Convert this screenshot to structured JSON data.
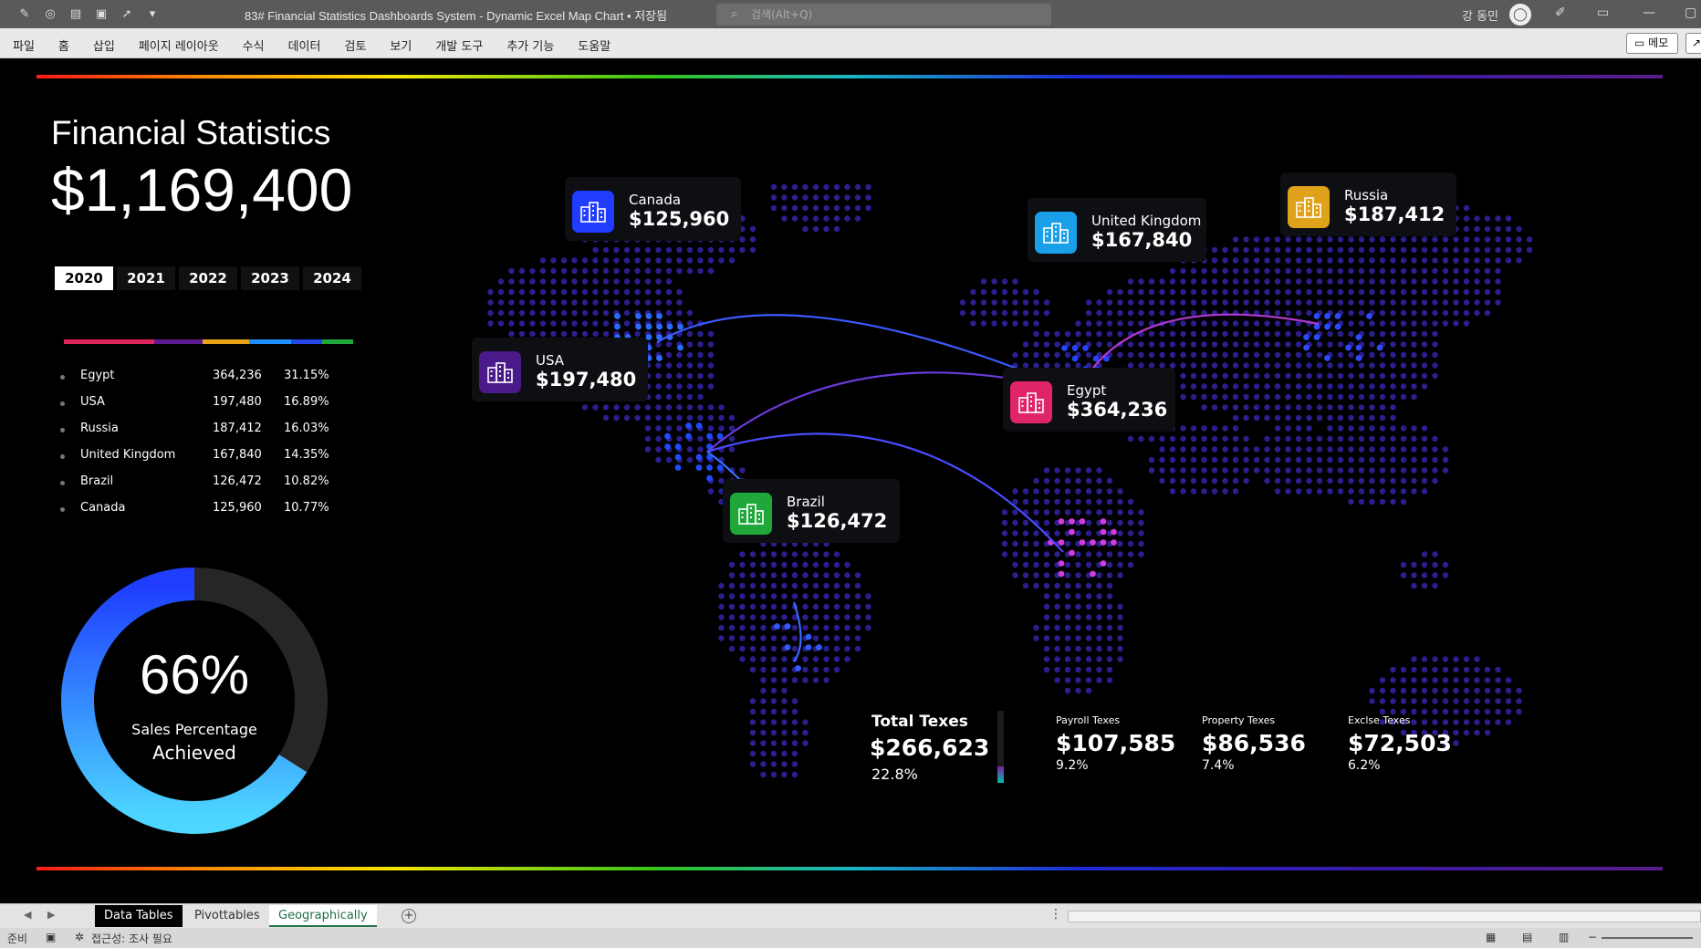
{
  "window": {
    "doc_title": "83# Financial Statistics Dashboards System - Dynamic Excel Map Chart • 저장됨",
    "search_placeholder": "검색(Alt+Q)",
    "user_name": "강 동민"
  },
  "ribbon": {
    "tabs": [
      "파일",
      "홈",
      "삽입",
      "페이지 레이아웃",
      "수식",
      "데이터",
      "검토",
      "보기",
      "개발 도구",
      "추가 기능",
      "도움말"
    ],
    "memo_label": "메모"
  },
  "dashboard": {
    "title": "Financial Statistics",
    "total": "$1,169,400",
    "years": [
      "2020",
      "2021",
      "2022",
      "2023",
      "2024"
    ],
    "active_year": "2020",
    "country_list": [
      {
        "name": "Egypt",
        "value": "364,236",
        "pct": "31.15%"
      },
      {
        "name": "USA",
        "value": "197,480",
        "pct": "16.89%"
      },
      {
        "name": "Russia",
        "value": "187,412",
        "pct": "16.03%"
      },
      {
        "name": "United Kingdom",
        "value": "167,840",
        "pct": "14.35%"
      },
      {
        "name": "Brazil",
        "value": "126,472",
        "pct": "10.82%"
      },
      {
        "name": "Canada",
        "value": "125,960",
        "pct": "10.77%"
      }
    ],
    "share_bar_colors": [
      "#e0245e",
      "#5c1a8f",
      "#e8a317",
      "#1f8fff",
      "#2447e6",
      "#1fa83a"
    ],
    "gauge": {
      "percent_value": 0.66,
      "percent_text": "66%",
      "label_line1": "Sales Percentage",
      "label_line2": "Achieved",
      "color_start": "#1e3dff",
      "color_end": "#4dd6ff",
      "track_color": "#262626"
    }
  },
  "map_cards": [
    {
      "name": "Canada",
      "value": "$125,960",
      "icon": "building-icon",
      "color": "#1f3cff"
    },
    {
      "name": "United Kingdom",
      "value": "$167,840",
      "icon": "building-icon",
      "color": "#1aa0e8"
    },
    {
      "name": "Russia",
      "value": "$187,412",
      "icon": "building-icon",
      "color": "#e0a21a"
    },
    {
      "name": "USA",
      "value": "$197,480",
      "icon": "building-icon",
      "color": "#4a1a8a"
    },
    {
      "name": "Egypt",
      "value": "$364,236",
      "icon": "building-icon",
      "color": "#e0246a"
    },
    {
      "name": "Brazil",
      "value": "$126,472",
      "icon": "building-icon",
      "color": "#1fa83a"
    }
  ],
  "taxes": {
    "total_label": "Total Texes",
    "total_value": "$266,623",
    "total_pct": "22.8%",
    "total_fraction": 0.228,
    "items": [
      {
        "label": "Payroll Texes",
        "value": "$107,585",
        "pct": "9.2%"
      },
      {
        "label": "Property Texes",
        "value": "$86,536",
        "pct": "7.4%"
      },
      {
        "label": "Exclse Texes",
        "value": "$72,503",
        "pct": "6.2%"
      }
    ]
  },
  "sheet_tabs": [
    "Data Tables",
    "Pivottables",
    "Geographically"
  ],
  "status": {
    "ready": "준비",
    "accessibility": "접근성: 조사 필요"
  }
}
